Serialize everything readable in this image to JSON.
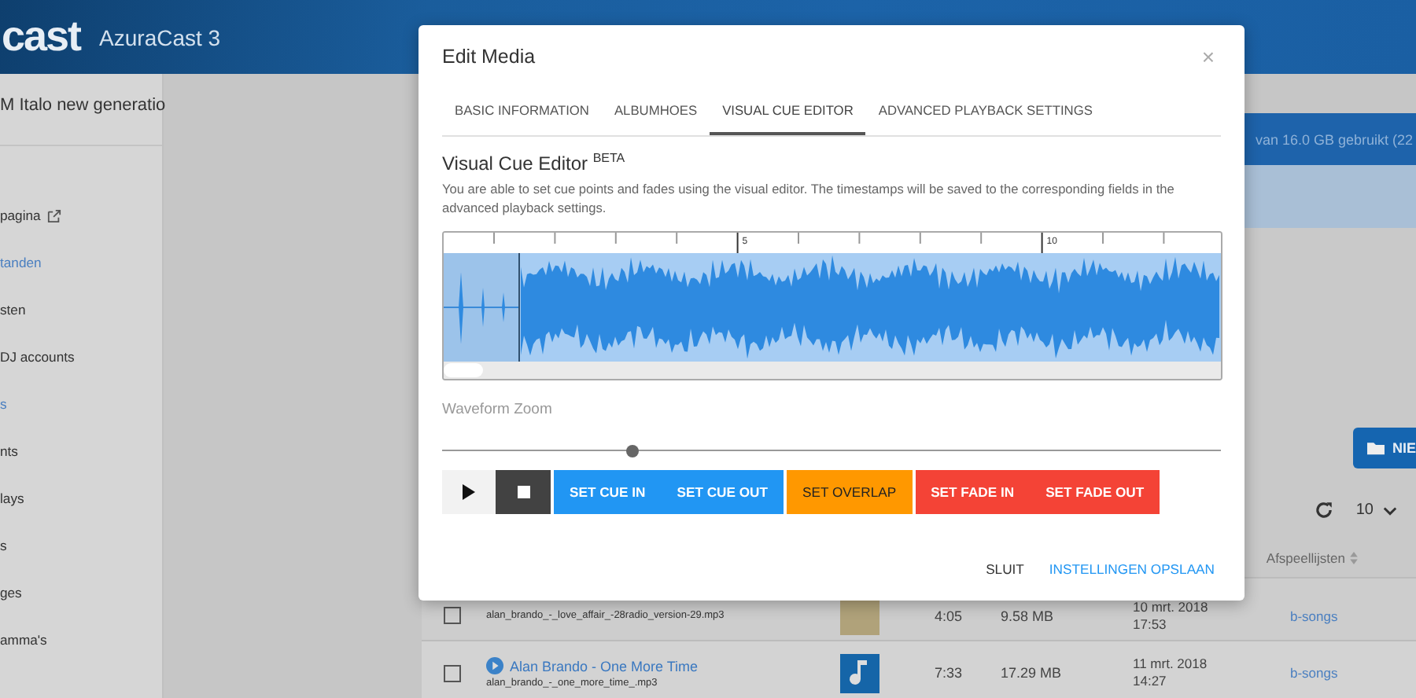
{
  "header": {
    "logo": "cast",
    "version": "AzuraCast 3"
  },
  "sidebar": {
    "station": "M Italo new generatio",
    "items": [
      {
        "label": "pagina",
        "external": true,
        "selected": false
      },
      {
        "label": "tanden",
        "external": false,
        "selected": true
      },
      {
        "label": "sten",
        "external": false,
        "selected": false
      },
      {
        "label": "DJ accounts",
        "external": false,
        "selected": false
      },
      {
        "label": "s",
        "external": false,
        "selected": true
      },
      {
        "label": "nts",
        "external": false,
        "selected": false
      },
      {
        "label": "lays",
        "external": false,
        "selected": false
      },
      {
        "label": "s",
        "external": false,
        "selected": false
      },
      {
        "label": "ges",
        "external": false,
        "selected": false
      },
      {
        "label": "amma's",
        "external": false,
        "selected": false
      }
    ]
  },
  "storage": {
    "text": "van 16.0 GB gebruikt (22"
  },
  "new_button": "NIE",
  "per_page": "10",
  "table": {
    "column_header": "Afspeellijsten",
    "rows": [
      {
        "checked": false,
        "filename": "alan_brando_-_love_affair_-28radio_version-29.mp3",
        "kind": "photo",
        "duration": "4:05",
        "size": "9.58 MB",
        "date": "10 mrt. 2018",
        "time": "17:53",
        "playlist": "b-songs"
      },
      {
        "checked": false,
        "title": "Alan Brando - One More Time",
        "filename": "alan_brando_-_one_more_time_.mp3",
        "kind": "music",
        "duration": "7:33",
        "size": "17.29 MB",
        "date": "11 mrt. 2018",
        "time": "14:27",
        "playlist": "b-songs"
      }
    ]
  },
  "modal": {
    "title": "Edit Media",
    "close": "×",
    "tabs": [
      {
        "label": "BASIC INFORMATION",
        "selected": false
      },
      {
        "label": "ALBUMHOES",
        "selected": false
      },
      {
        "label": "VISUAL CUE EDITOR",
        "selected": true
      },
      {
        "label": "ADVANCED PLAYBACK SETTINGS",
        "selected": false
      }
    ],
    "heading": "Visual Cue Editor $^{BETA}$",
    "description": "You are able to set cue points and fades using the visual editor. The timestamps will be saved to the corresponding fields in the advanced playback settings.",
    "ruler_labels": [
      "5",
      "10"
    ],
    "zoom_label": "Waveform Zoom",
    "zoom": {
      "level": 0.245
    },
    "buttons": [
      {
        "kind": "play"
      },
      {
        "kind": "stop"
      },
      {
        "kind": "cue",
        "label": "SET CUE IN"
      },
      {
        "kind": "cue",
        "label": "SET CUE OUT"
      },
      {
        "kind": "overlap",
        "label": "SET OVERLAP"
      },
      {
        "kind": "fade",
        "label": "SET FADE IN"
      },
      {
        "kind": "fade",
        "label": "SET FADE OUT"
      }
    ],
    "footer": [
      "SLUIT",
      "INSTELLINGEN OPSLAAN"
    ]
  }
}
